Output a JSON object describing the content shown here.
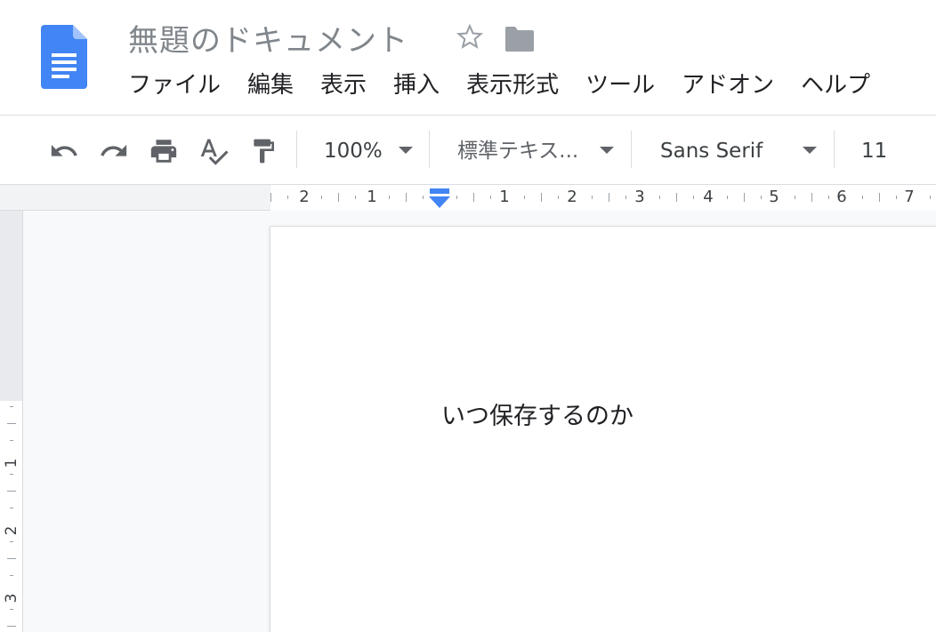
{
  "document": {
    "title": "無題のドキュメント"
  },
  "menu": {
    "items": [
      "ファイル",
      "編集",
      "表示",
      "挿入",
      "表示形式",
      "ツール",
      "アドオン",
      "ヘルプ"
    ]
  },
  "toolbar": {
    "zoom": "100%",
    "style": "標準テキス...",
    "font": "Sans Serif",
    "font_size": "11"
  },
  "ruler": {
    "labels": [
      "2",
      "1",
      "1",
      "2",
      "3",
      "4",
      "5",
      "6",
      "7"
    ]
  },
  "vruler": {
    "labels": [
      "1",
      "2",
      "3"
    ]
  },
  "content": {
    "text": "いつ保存するのか"
  },
  "colors": {
    "docs_blue": "#4285f4",
    "indent_blue": "#4285f4"
  }
}
